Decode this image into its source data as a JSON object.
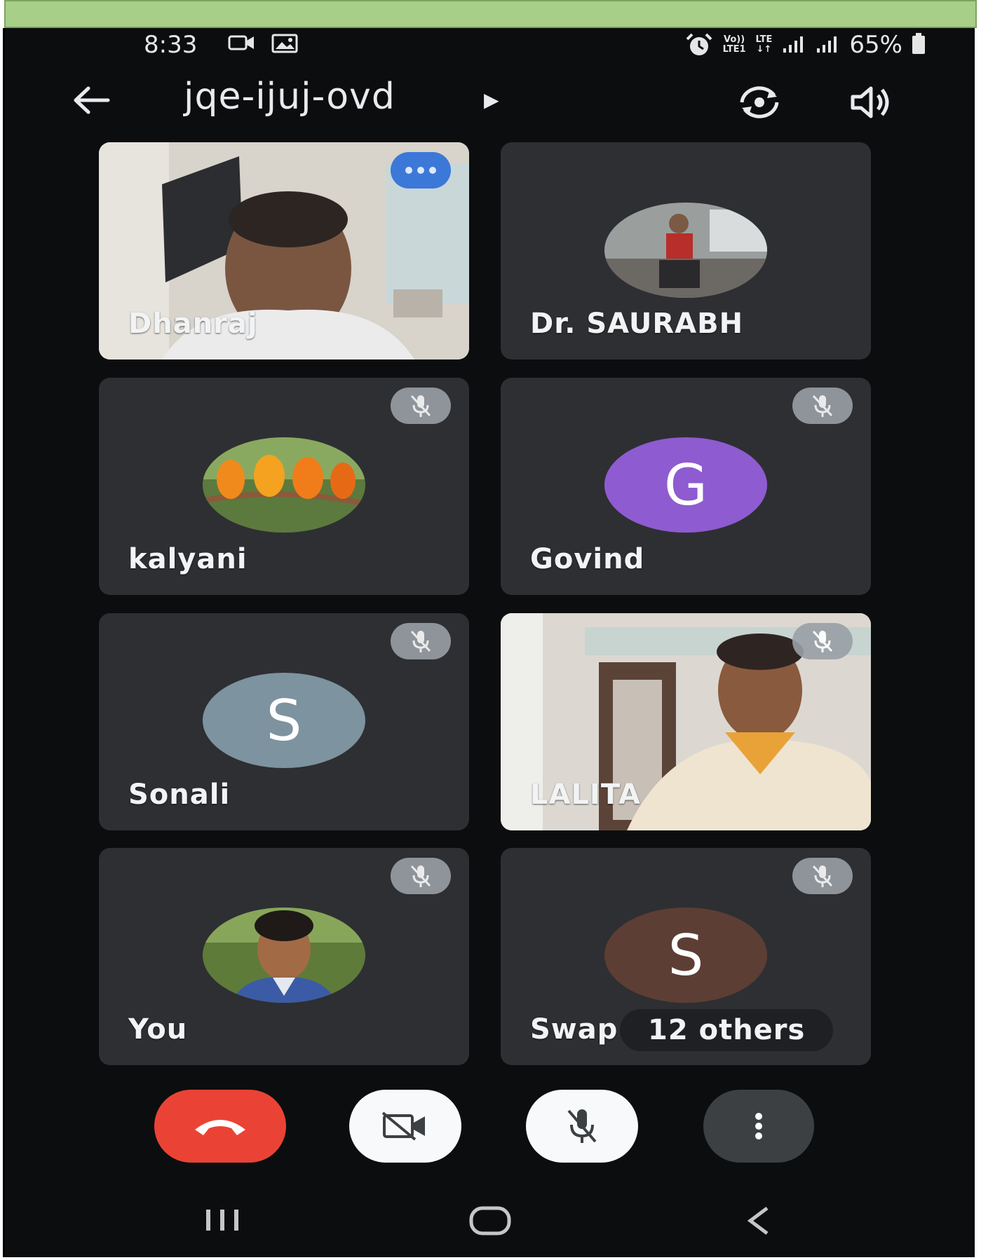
{
  "status_bar": {
    "time": "8:33",
    "network_top": "Vo))",
    "network_bottom": "LTE1",
    "lte_top": "LTE",
    "lte_bottom": "↓↑",
    "battery": "65%"
  },
  "header": {
    "meeting_code": "jqe-ijuj-ovd"
  },
  "tiles": [
    {
      "name": "Dhanraj",
      "type": "video"
    },
    {
      "name": "Dr. SAURABH",
      "type": "photo"
    },
    {
      "name": "kalyani",
      "type": "photo",
      "muted": true
    },
    {
      "name": "Govind",
      "type": "initial",
      "initial": "G",
      "color": "#8e5bd1",
      "muted": true
    },
    {
      "name": "Sonali",
      "type": "initial",
      "initial": "S",
      "color": "#7d939f",
      "muted": true
    },
    {
      "name": "LALITA",
      "type": "video",
      "muted": true
    },
    {
      "name": "You",
      "type": "photo",
      "muted": true
    },
    {
      "name": "Swap",
      "type": "initial",
      "initial": "S",
      "color": "#5d3e34",
      "muted": true
    }
  ],
  "others_chip": "12 others",
  "colors": {
    "end_call": "#ea4335",
    "tile_bg": "#2e2f32",
    "background": "#0c0d0f"
  }
}
